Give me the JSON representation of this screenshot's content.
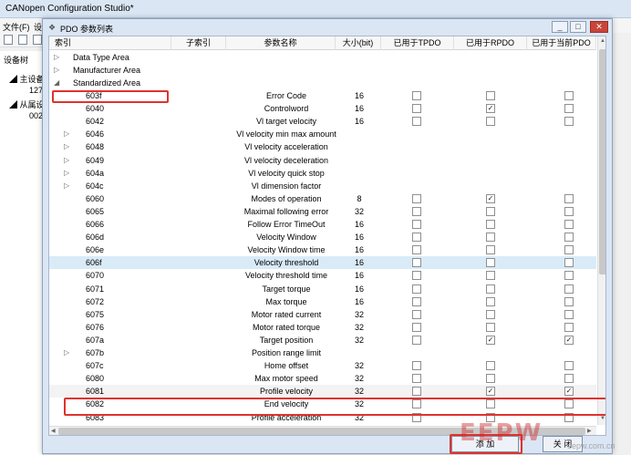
{
  "app": {
    "title": "CANopen Configuration Studio*",
    "menu_file": "文件(F)",
    "menu_settings": "设",
    "tree_header": "设备树",
    "tree_master": "主设备",
    "tree_master_child": "127",
    "tree_slave": "从属设",
    "tree_slave_child": "002"
  },
  "dialog": {
    "title": "PDO 参数列表",
    "minimize": "_",
    "maximize": "□",
    "close": "✕",
    "columns": [
      "索引",
      "子索引",
      "参数名称",
      "大小(bit)",
      "已用于TPDO",
      "已用于RPDO",
      "已用于当前PDO"
    ],
    "groups": [
      "Data Type Area",
      "Manufacturer Area",
      "Standardized Area"
    ],
    "rows": [
      {
        "index": "603f",
        "name": "Error Code",
        "size": "16",
        "tpdo": false,
        "rpdo": false,
        "cur": false,
        "expandable": false,
        "has_cb": true
      },
      {
        "index": "6040",
        "name": "Controlword",
        "size": "16",
        "tpdo": false,
        "rpdo": true,
        "cur": false,
        "expandable": false,
        "has_cb": true
      },
      {
        "index": "6042",
        "name": "Vl target velocity",
        "size": "16",
        "tpdo": false,
        "rpdo": false,
        "cur": false,
        "expandable": false,
        "has_cb": true
      },
      {
        "index": "6046",
        "name": "Vl velocity min max amount",
        "size": "",
        "expandable": true,
        "has_cb": false
      },
      {
        "index": "6048",
        "name": "Vl velocity acceleration",
        "size": "",
        "expandable": true,
        "has_cb": false
      },
      {
        "index": "6049",
        "name": "Vl velocity deceleration",
        "size": "",
        "expandable": true,
        "has_cb": false
      },
      {
        "index": "604a",
        "name": "Vl velocity quick stop",
        "size": "",
        "expandable": true,
        "has_cb": false
      },
      {
        "index": "604c",
        "name": "Vl dimension factor",
        "size": "",
        "expandable": true,
        "has_cb": false
      },
      {
        "index": "6060",
        "name": "Modes of operation",
        "size": "8",
        "tpdo": false,
        "rpdo": true,
        "cur": false,
        "expandable": false,
        "has_cb": true
      },
      {
        "index": "6065",
        "name": "Maximal following error",
        "size": "32",
        "tpdo": false,
        "rpdo": false,
        "cur": false,
        "expandable": false,
        "has_cb": true
      },
      {
        "index": "6066",
        "name": "Follow Error TimeOut",
        "size": "16",
        "tpdo": false,
        "rpdo": false,
        "cur": false,
        "expandable": false,
        "has_cb": true
      },
      {
        "index": "606d",
        "name": "Velocity Window",
        "size": "16",
        "tpdo": false,
        "rpdo": false,
        "cur": false,
        "expandable": false,
        "has_cb": true
      },
      {
        "index": "606e",
        "name": "Velocity Window time",
        "size": "16",
        "tpdo": false,
        "rpdo": false,
        "cur": false,
        "expandable": false,
        "has_cb": true
      },
      {
        "index": "606f",
        "name": "Velocity threshold",
        "size": "16",
        "tpdo": false,
        "rpdo": false,
        "cur": false,
        "expandable": false,
        "has_cb": true,
        "selected": true
      },
      {
        "index": "6070",
        "name": "Velocity threshold time",
        "size": "16",
        "tpdo": false,
        "rpdo": false,
        "cur": false,
        "expandable": false,
        "has_cb": true
      },
      {
        "index": "6071",
        "name": "Target torque",
        "size": "16",
        "tpdo": false,
        "rpdo": false,
        "cur": false,
        "expandable": false,
        "has_cb": true
      },
      {
        "index": "6072",
        "name": "Max torque",
        "size": "16",
        "tpdo": false,
        "rpdo": false,
        "cur": false,
        "expandable": false,
        "has_cb": true
      },
      {
        "index": "6075",
        "name": "Motor rated current",
        "size": "32",
        "tpdo": false,
        "rpdo": false,
        "cur": false,
        "expandable": false,
        "has_cb": true
      },
      {
        "index": "6076",
        "name": "Motor rated torque",
        "size": "32",
        "tpdo": false,
        "rpdo": false,
        "cur": false,
        "expandable": false,
        "has_cb": true
      },
      {
        "index": "607a",
        "name": "Target position",
        "size": "32",
        "tpdo": false,
        "rpdo": true,
        "cur": true,
        "expandable": false,
        "has_cb": true
      },
      {
        "index": "607b",
        "name": "Position range limit",
        "size": "",
        "expandable": true,
        "has_cb": false
      },
      {
        "index": "607c",
        "name": "Home offset",
        "size": "32",
        "tpdo": false,
        "rpdo": false,
        "cur": false,
        "expandable": false,
        "has_cb": true
      },
      {
        "index": "6080",
        "name": "Max motor speed",
        "size": "32",
        "tpdo": false,
        "rpdo": false,
        "cur": false,
        "expandable": false,
        "has_cb": true
      },
      {
        "index": "6081",
        "name": "Profile velocity",
        "size": "32",
        "tpdo": false,
        "rpdo": true,
        "cur": true,
        "expandable": false,
        "has_cb": true,
        "hover": true
      },
      {
        "index": "6082",
        "name": "End velocity",
        "size": "32",
        "tpdo": false,
        "rpdo": false,
        "cur": false,
        "expandable": false,
        "has_cb": true
      },
      {
        "index": "6083",
        "name": "Profile acceleration",
        "size": "32",
        "tpdo": false,
        "rpdo": false,
        "cur": false,
        "expandable": false,
        "has_cb": true
      }
    ],
    "add_button": "添 加",
    "close_button": "关 闭",
    "highlight_color": "#e0322e",
    "selected_color": "#d9ebf7"
  },
  "watermark": {
    "logo": "EEPW",
    "site": "eepw.com.cn"
  }
}
